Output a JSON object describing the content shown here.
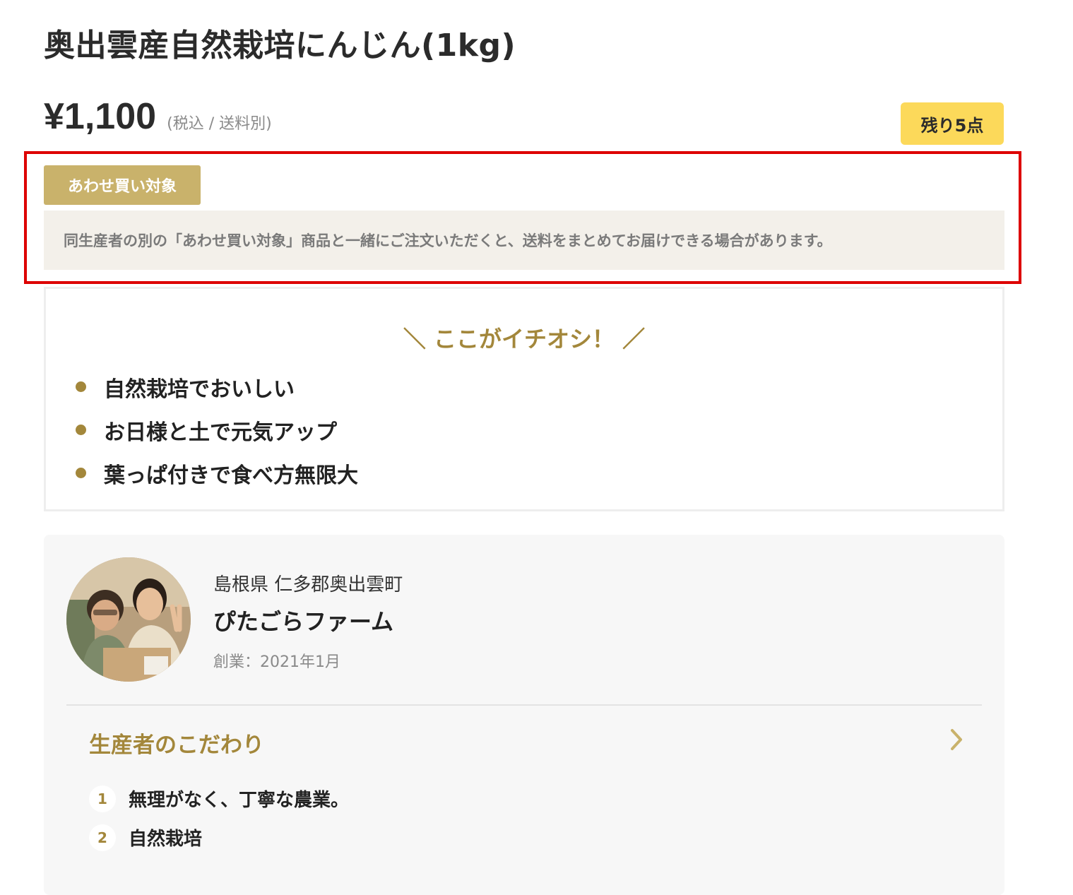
{
  "product": {
    "title": "奥出雲産自然栽培にんじん(1kg)",
    "price": "¥1,100",
    "price_note": "(税込 / 送料別)",
    "stock_badge": "残り5点"
  },
  "bundle": {
    "tag": "あわせ買い対象",
    "notice": "同生産者の別の「あわせ買い対象」商品と一緒にご注文いただくと、送料をまとめてお届けできる場合があります。"
  },
  "recommend": {
    "heading": "＼ ここがイチオシ！ ／",
    "items": [
      "自然栽培でおいしい",
      "お日様と土で元気アップ",
      "葉っぱ付きで食べ方無限大"
    ]
  },
  "producer": {
    "location": "島根県 仁多郡奥出雲町",
    "name": "ぴたごらファーム",
    "founded": "創業：2021年1月",
    "kodawari_title": "生産者のこだわり",
    "kodawari_items": [
      {
        "num": "1",
        "text": "無理がなく、丁寧な農業。"
      },
      {
        "num": "2",
        "text": "自然栽培"
      }
    ]
  },
  "colors": {
    "accent_gold": "#a3873b",
    "tag_gold": "#c9b26b",
    "stock_yellow": "#fcd95a",
    "highlight_red": "#dd0000"
  }
}
